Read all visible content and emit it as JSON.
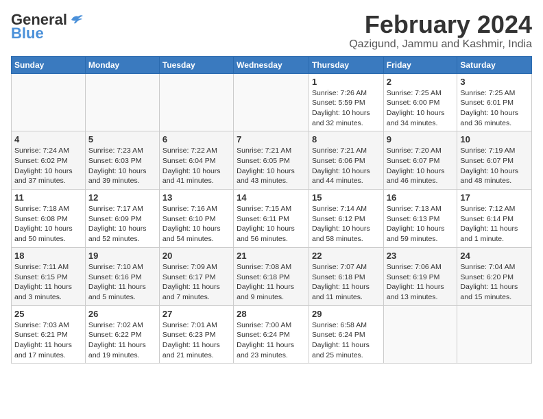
{
  "logo": {
    "general": "General",
    "blue": "Blue"
  },
  "title": "February 2024",
  "location": "Qazigund, Jammu and Kashmir, India",
  "weekdays": [
    "Sunday",
    "Monday",
    "Tuesday",
    "Wednesday",
    "Thursday",
    "Friday",
    "Saturday"
  ],
  "weeks": [
    [
      {
        "day": "",
        "info": ""
      },
      {
        "day": "",
        "info": ""
      },
      {
        "day": "",
        "info": ""
      },
      {
        "day": "",
        "info": ""
      },
      {
        "day": "1",
        "info": "Sunrise: 7:26 AM\nSunset: 5:59 PM\nDaylight: 10 hours\nand 32 minutes."
      },
      {
        "day": "2",
        "info": "Sunrise: 7:25 AM\nSunset: 6:00 PM\nDaylight: 10 hours\nand 34 minutes."
      },
      {
        "day": "3",
        "info": "Sunrise: 7:25 AM\nSunset: 6:01 PM\nDaylight: 10 hours\nand 36 minutes."
      }
    ],
    [
      {
        "day": "4",
        "info": "Sunrise: 7:24 AM\nSunset: 6:02 PM\nDaylight: 10 hours\nand 37 minutes."
      },
      {
        "day": "5",
        "info": "Sunrise: 7:23 AM\nSunset: 6:03 PM\nDaylight: 10 hours\nand 39 minutes."
      },
      {
        "day": "6",
        "info": "Sunrise: 7:22 AM\nSunset: 6:04 PM\nDaylight: 10 hours\nand 41 minutes."
      },
      {
        "day": "7",
        "info": "Sunrise: 7:21 AM\nSunset: 6:05 PM\nDaylight: 10 hours\nand 43 minutes."
      },
      {
        "day": "8",
        "info": "Sunrise: 7:21 AM\nSunset: 6:06 PM\nDaylight: 10 hours\nand 44 minutes."
      },
      {
        "day": "9",
        "info": "Sunrise: 7:20 AM\nSunset: 6:07 PM\nDaylight: 10 hours\nand 46 minutes."
      },
      {
        "day": "10",
        "info": "Sunrise: 7:19 AM\nSunset: 6:07 PM\nDaylight: 10 hours\nand 48 minutes."
      }
    ],
    [
      {
        "day": "11",
        "info": "Sunrise: 7:18 AM\nSunset: 6:08 PM\nDaylight: 10 hours\nand 50 minutes."
      },
      {
        "day": "12",
        "info": "Sunrise: 7:17 AM\nSunset: 6:09 PM\nDaylight: 10 hours\nand 52 minutes."
      },
      {
        "day": "13",
        "info": "Sunrise: 7:16 AM\nSunset: 6:10 PM\nDaylight: 10 hours\nand 54 minutes."
      },
      {
        "day": "14",
        "info": "Sunrise: 7:15 AM\nSunset: 6:11 PM\nDaylight: 10 hours\nand 56 minutes."
      },
      {
        "day": "15",
        "info": "Sunrise: 7:14 AM\nSunset: 6:12 PM\nDaylight: 10 hours\nand 58 minutes."
      },
      {
        "day": "16",
        "info": "Sunrise: 7:13 AM\nSunset: 6:13 PM\nDaylight: 10 hours\nand 59 minutes."
      },
      {
        "day": "17",
        "info": "Sunrise: 7:12 AM\nSunset: 6:14 PM\nDaylight: 11 hours\nand 1 minute."
      }
    ],
    [
      {
        "day": "18",
        "info": "Sunrise: 7:11 AM\nSunset: 6:15 PM\nDaylight: 11 hours\nand 3 minutes."
      },
      {
        "day": "19",
        "info": "Sunrise: 7:10 AM\nSunset: 6:16 PM\nDaylight: 11 hours\nand 5 minutes."
      },
      {
        "day": "20",
        "info": "Sunrise: 7:09 AM\nSunset: 6:17 PM\nDaylight: 11 hours\nand 7 minutes."
      },
      {
        "day": "21",
        "info": "Sunrise: 7:08 AM\nSunset: 6:18 PM\nDaylight: 11 hours\nand 9 minutes."
      },
      {
        "day": "22",
        "info": "Sunrise: 7:07 AM\nSunset: 6:18 PM\nDaylight: 11 hours\nand 11 minutes."
      },
      {
        "day": "23",
        "info": "Sunrise: 7:06 AM\nSunset: 6:19 PM\nDaylight: 11 hours\nand 13 minutes."
      },
      {
        "day": "24",
        "info": "Sunrise: 7:04 AM\nSunset: 6:20 PM\nDaylight: 11 hours\nand 15 minutes."
      }
    ],
    [
      {
        "day": "25",
        "info": "Sunrise: 7:03 AM\nSunset: 6:21 PM\nDaylight: 11 hours\nand 17 minutes."
      },
      {
        "day": "26",
        "info": "Sunrise: 7:02 AM\nSunset: 6:22 PM\nDaylight: 11 hours\nand 19 minutes."
      },
      {
        "day": "27",
        "info": "Sunrise: 7:01 AM\nSunset: 6:23 PM\nDaylight: 11 hours\nand 21 minutes."
      },
      {
        "day": "28",
        "info": "Sunrise: 7:00 AM\nSunset: 6:24 PM\nDaylight: 11 hours\nand 23 minutes."
      },
      {
        "day": "29",
        "info": "Sunrise: 6:58 AM\nSunset: 6:24 PM\nDaylight: 11 hours\nand 25 minutes."
      },
      {
        "day": "",
        "info": ""
      },
      {
        "day": "",
        "info": ""
      }
    ]
  ]
}
